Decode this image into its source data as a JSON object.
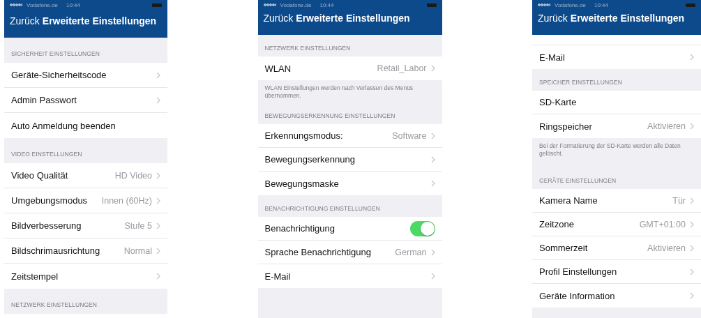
{
  "screens": [
    {
      "status_bar": {
        "carrier": "Vodafone.de",
        "time": "10:44"
      },
      "nav_bar": {
        "back": "Zurück",
        "title": "Erweiterte Einstellungen"
      },
      "sections": [
        {
          "header": "SICHERHEIT EINSTELLUNGEN",
          "rows": [
            {
              "kind": "link",
              "label": "Geräte-Sicherheitscode"
            },
            {
              "kind": "link",
              "label": "Admin Passwort"
            },
            {
              "kind": "plain",
              "label": "Auto Anmeldung beenden"
            }
          ]
        },
        {
          "header": "VIDEO EINSTELLUNGEN",
          "rows": [
            {
              "kind": "link",
              "label": "Video Qualität",
              "value": "HD Video"
            },
            {
              "kind": "link",
              "label": "Umgebungsmodus",
              "value": "Innen (60Hz)"
            },
            {
              "kind": "link",
              "label": "Bildverbesserung",
              "value": "Stufe 5"
            },
            {
              "kind": "link",
              "label": "Bildschrimausrichtung",
              "value": "Normal"
            },
            {
              "kind": "link",
              "label": "Zeitstempel"
            }
          ]
        },
        {
          "header": "NETZWERK EINSTELLUNGEN",
          "continues": true
        }
      ]
    },
    {
      "status_bar": {
        "carrier": "Vodafone.de",
        "time": "10:44"
      },
      "nav_bar": {
        "back": "Zurück",
        "title": "Erweiterte Einstellungen"
      },
      "sections": [
        {
          "header": "NETZWERK EINSTELLUNGEN",
          "rows": [
            {
              "kind": "link",
              "label": "WLAN",
              "value": "Retail_Labor"
            }
          ],
          "footer": "WLAN Einstellungen werden nach Verlassen des Menüs übernommen."
        },
        {
          "header": "BEWEGUNGSERKENNUNG EINSTELLUNGEN",
          "rows": [
            {
              "kind": "link",
              "label": "Erkennungsmodus:",
              "value": "Software"
            },
            {
              "kind": "link",
              "label": "Bewegungserkennung"
            },
            {
              "kind": "link",
              "label": "Bewegungsmaske"
            }
          ]
        },
        {
          "header": "BENACHRICHTIGUNG EINSTELLUNGEN",
          "rows": [
            {
              "kind": "toggle",
              "label": "Benachrichtigung",
              "on": true
            },
            {
              "kind": "link",
              "label": "Sprache Benachrichtigung",
              "value": "German"
            },
            {
              "kind": "link",
              "label": "E-Mail"
            }
          ]
        }
      ]
    },
    {
      "status_bar": {
        "carrier": "Vodafone.de",
        "time": "10:44"
      },
      "nav_bar": {
        "back": "Zurück",
        "title": "Erweiterte Einstellungen"
      },
      "sections": [
        {
          "continued": true,
          "rows": [
            {
              "kind": "link",
              "label": "E-Mail"
            }
          ]
        },
        {
          "header": "SPEICHER EINSTELLUNGEN",
          "rows": [
            {
              "kind": "plain",
              "label": "SD-Karte"
            },
            {
              "kind": "link",
              "label": "Ringspeicher",
              "value": "Aktivieren"
            }
          ],
          "footer": "Bei der Formatierung der SD-Karte werden alle Daten gelöscht."
        },
        {
          "header": "GERÄTE EINSTELLUNGEN",
          "rows": [
            {
              "kind": "link",
              "label": "Kamera Name",
              "value": "Tür"
            },
            {
              "kind": "link",
              "label": "Zeitzone",
              "value": "GMT+01:00"
            },
            {
              "kind": "link",
              "label": "Sommerzeit",
              "value": "Aktivieren"
            },
            {
              "kind": "link",
              "label": "Profil Einstellungen"
            },
            {
              "kind": "link",
              "label": "Geräte Information"
            }
          ]
        }
      ]
    }
  ]
}
